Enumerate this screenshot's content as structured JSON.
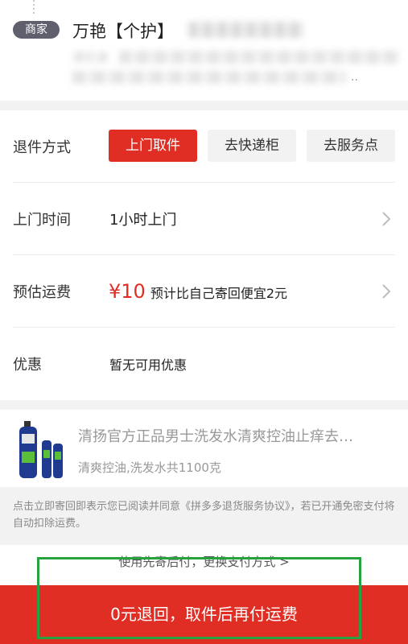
{
  "address": {
    "badge": "商家",
    "name": "万艳【个护】",
    "line1_prefix": "湖北省",
    "ellipsis": "..",
    "phone_blurred": true
  },
  "return_method": {
    "label": "退件方式",
    "options": [
      "上门取件",
      "去快递柜",
      "去服务点"
    ],
    "selected": "上门取件"
  },
  "pickup_time": {
    "label": "上门时间",
    "value": "1小时上门"
  },
  "shipping": {
    "label": "预估运费",
    "price": "¥10",
    "note": "预计比自己寄回便宜2元"
  },
  "discount": {
    "label": "优惠",
    "value": "暂无可用优惠"
  },
  "product": {
    "title": "清扬官方正品男士洗发水清爽控油止痒去…",
    "spec": "清爽控油,洗发水共1100克"
  },
  "notice": {
    "text": "点击立即寄回即表示您已阅读并同意《拼多多退货服务协议》，若已开通免密支付将自动扣除运费。"
  },
  "pay_link": "使用先寄后付，更换支付方式 >",
  "submit_label": "0元退回，取件后再付运费",
  "colors": {
    "accent": "#e02e24",
    "badge_bg": "#5f5f6d",
    "highlight": "#26a33f"
  }
}
